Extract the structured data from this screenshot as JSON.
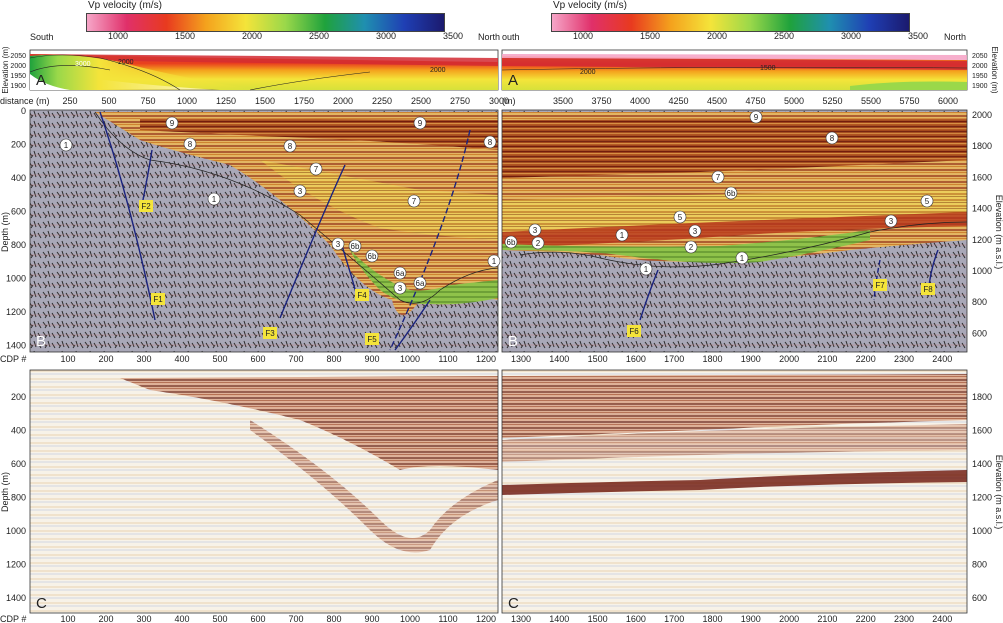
{
  "colorbar": {
    "title": "Vp velocity (m/s)",
    "ticks": [
      "1000",
      "1500",
      "2000",
      "2500",
      "3000",
      "3500"
    ],
    "stops": [
      "#f6a6c8",
      "#e0306a",
      "#e83a1f",
      "#f4a21d",
      "#f4e43a",
      "#9ad84a",
      "#1fa23c",
      "#1f8fb0",
      "#1f3fb4",
      "#1b1a6e"
    ]
  },
  "left": {
    "south_label": "South",
    "north_label": "North",
    "panel_a_letter": "A",
    "panel_b_letter": "B",
    "panel_c_letter": "C",
    "distance_label": "distance (m)",
    "distance_ticks": [
      "250",
      "500",
      "750",
      "1000",
      "1250",
      "1500",
      "1750",
      "2000",
      "2250",
      "2500",
      "2750",
      "3000"
    ],
    "elev_axis_label": "Elevation (m)",
    "elev_ticks": [
      "2050",
      "2000",
      "1950",
      "1900"
    ],
    "contours": [
      "3000",
      "2000",
      "2000"
    ],
    "depth_label": "Depth (m)",
    "depth_ticks": [
      "0",
      "200",
      "400",
      "600",
      "800",
      "1000",
      "1200",
      "1400"
    ],
    "depth_ticks_c": [
      "200",
      "400",
      "600",
      "800",
      "1000",
      "1200",
      "1400"
    ],
    "cdp_label": "CDP #",
    "cdp_ticks": [
      "100",
      "200",
      "300",
      "400",
      "500",
      "600",
      "700",
      "800",
      "900",
      "1000",
      "1100",
      "1200"
    ],
    "faults": [
      "F1",
      "F2",
      "F3",
      "F4",
      "F5"
    ],
    "units": [
      "9",
      "9",
      "8",
      "8",
      "8",
      "1",
      "1",
      "7",
      "7",
      "3",
      "3",
      "3",
      "6b",
      "6b",
      "6a",
      "6a",
      "1"
    ]
  },
  "right": {
    "south_label": "South",
    "north_label": "North",
    "panel_a_letter": "A",
    "panel_b_letter": "B",
    "panel_c_letter": "C",
    "distance_label": "(m)",
    "distance_ticks": [
      "3500",
      "3750",
      "4000",
      "4250",
      "4500",
      "4750",
      "5000",
      "5250",
      "5500",
      "5750",
      "6000"
    ],
    "elev_axis_label": "Elevation (m)",
    "elev_ticks": [
      "2050",
      "2000",
      "1950",
      "1900"
    ],
    "contours": [
      "2000",
      "1500"
    ],
    "elev_axis_label_b": "Elevation (m a.s.l.)",
    "elev_ticks_b": [
      "2000",
      "1800",
      "1600",
      "1400",
      "1200",
      "1000",
      "800",
      "600"
    ],
    "cdp_ticks": [
      "1300",
      "1400",
      "1500",
      "1600",
      "1700",
      "1800",
      "1900",
      "2000",
      "2100",
      "2200",
      "2300",
      "2400"
    ],
    "faults": [
      "F6",
      "F7",
      "F8"
    ],
    "units": [
      "9",
      "8",
      "7",
      "6b",
      "5",
      "5",
      "6b",
      "3",
      "3",
      "3",
      "2",
      "2",
      "1",
      "1",
      "1"
    ]
  }
}
